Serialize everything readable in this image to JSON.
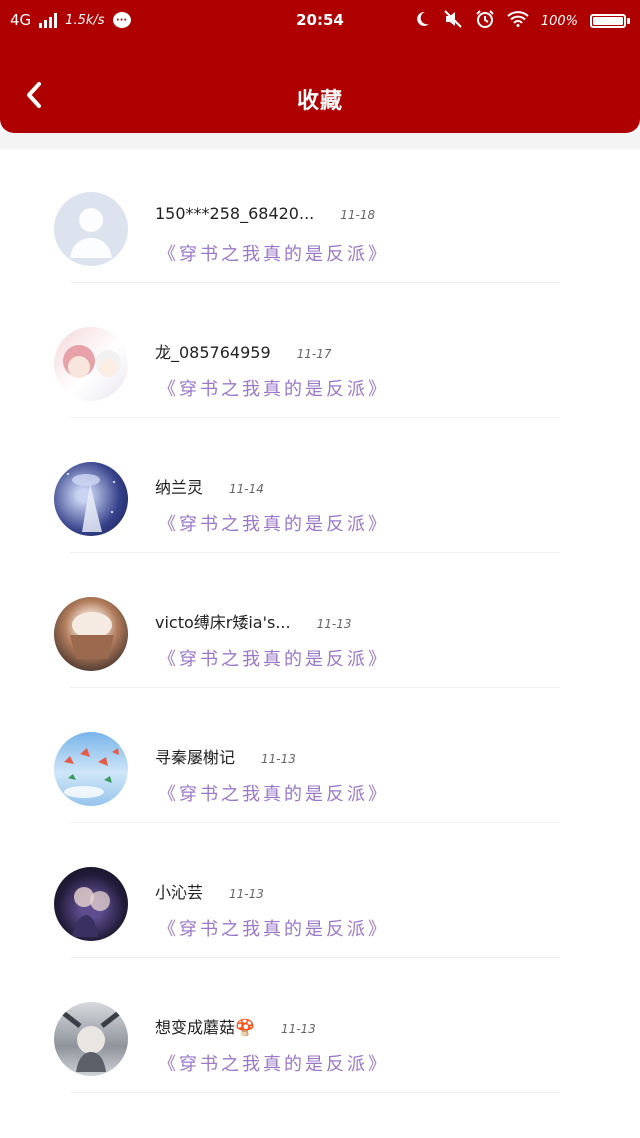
{
  "status_bar": {
    "network": "4G",
    "speed": "1.5k/s",
    "time": "20:54",
    "battery": "100%"
  },
  "header": {
    "title": "收藏"
  },
  "items": [
    {
      "name": "150***258_68420...",
      "date": "11-18",
      "book": "《穿书之我真的是反派》",
      "avatar": "default-user-icon"
    },
    {
      "name": "龙_085764959",
      "date": "11-17",
      "book": "《穿书之我真的是反派》",
      "avatar": "anime-avatar"
    },
    {
      "name": "纳兰灵",
      "date": "11-14",
      "book": "《穿书之我真的是反派》",
      "avatar": "night-avatar"
    },
    {
      "name": "victo缚床r矮ia's...",
      "date": "11-13",
      "book": "《穿书之我真的是反派》",
      "avatar": "cake-avatar"
    },
    {
      "name": "寻秦屡榭记",
      "date": "11-13",
      "book": "《穿书之我真的是反派》",
      "avatar": "sky-avatar"
    },
    {
      "name": "小沁芸",
      "date": "11-13",
      "book": "《穿书之我真的是反派》",
      "avatar": "dark-avatar"
    },
    {
      "name": "想变成蘑菇🍄",
      "date": "11-13",
      "book": "《穿书之我真的是反派》",
      "avatar": "gray-avatar"
    }
  ],
  "colors": {
    "header_bg": "#ae0000",
    "book_text": "#9a78c8"
  }
}
